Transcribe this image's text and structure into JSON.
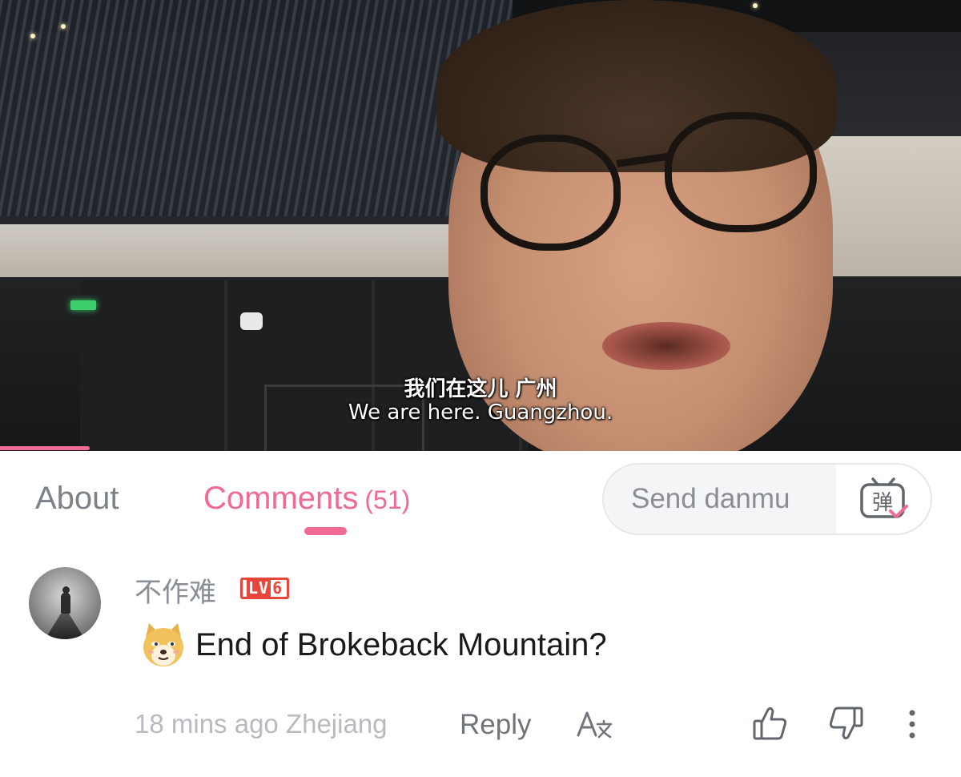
{
  "video": {
    "subtitle_zh": "我们在这儿 广州",
    "subtitle_en": "We are here. Guangzhou.",
    "progress_fraction": 0.093
  },
  "tabs": {
    "about_label": "About",
    "comments_label": "Comments",
    "comments_count": "(51)",
    "active": "comments"
  },
  "danmu": {
    "placeholder": "Send danmu",
    "toggle_icon": "danmu-toggle-icon",
    "toggle_glyph": "弹"
  },
  "comment": {
    "username": "不作难",
    "level_prefix": "LV",
    "level_value": "6",
    "emoji_icon": "doge-emoji-icon",
    "text": "End of Brokeback Mountain?",
    "time_location": "18 mins ago Zhejiang",
    "reply_label": "Reply",
    "translate_icon": "translate-icon",
    "like_icon": "thumbs-up-icon",
    "dislike_icon": "thumbs-down-icon",
    "more_icon": "more-vertical-icon"
  },
  "colors": {
    "accent_pink": "#f06a94",
    "level_red": "#e8453c",
    "muted_gray": "#8a8f95"
  }
}
